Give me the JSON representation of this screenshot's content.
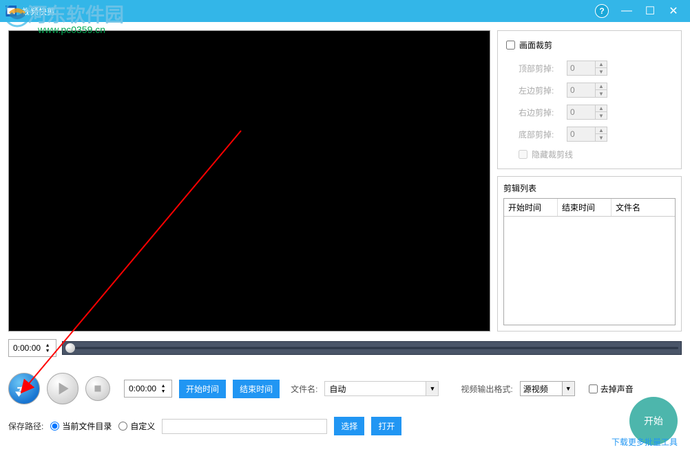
{
  "window": {
    "title": "视频快剪"
  },
  "watermark": {
    "text": "河东软件园",
    "url": "www.pc0359.cn"
  },
  "crop_panel": {
    "title": "画面裁剪",
    "top_label": "顶部剪掉:",
    "left_label": "左边剪掉:",
    "right_label": "右边剪掉:",
    "bottom_label": "底部剪掉:",
    "top_val": "0",
    "left_val": "0",
    "right_val": "0",
    "bottom_val": "0",
    "hide_lines": "隐藏裁剪线"
  },
  "clip_list": {
    "title": "剪辑列表",
    "col_start": "开始时间",
    "col_end": "结束时间",
    "col_file": "文件名"
  },
  "timeline": {
    "current_time": "0:00:00"
  },
  "controls": {
    "set_time": "0:00:00",
    "start_trim_btn": "开始时间",
    "end_trim_btn": "结束时间",
    "filename_label": "文件名:",
    "filename_value": "自动",
    "format_label": "视频输出格式:",
    "format_value": "源视频",
    "mute_label": "去掉声音"
  },
  "path": {
    "label": "保存路径:",
    "opt_current": "当前文件目录",
    "opt_custom": "自定义",
    "browse_btn": "选择",
    "open_btn": "打开"
  },
  "start_btn": "开始",
  "more_link": "下载更多批量工具"
}
